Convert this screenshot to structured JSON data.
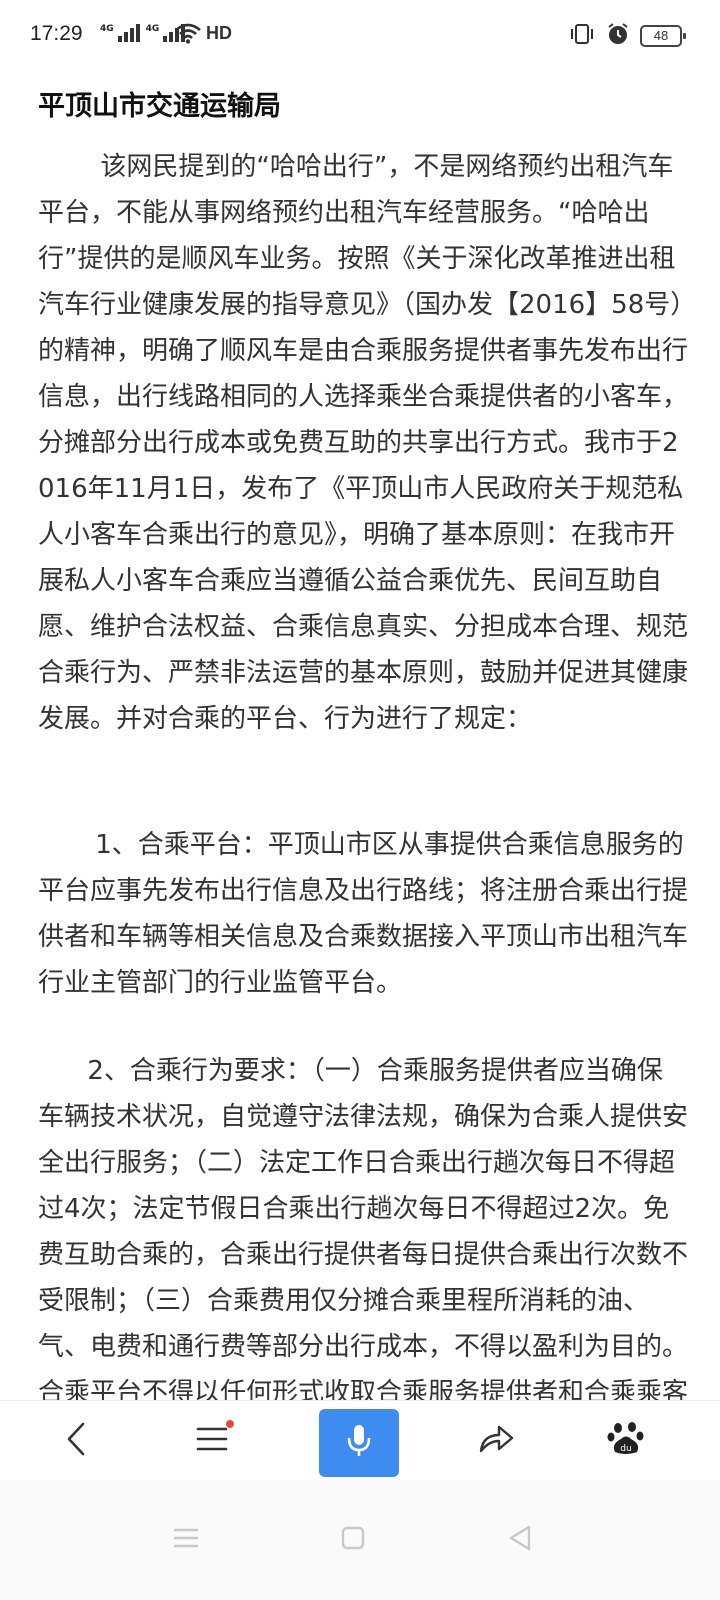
{
  "status_bar": {
    "time": "17:29",
    "signal1_label": "4G",
    "signal2_label": "4G",
    "hd_label": "HD",
    "battery_level": "48"
  },
  "article": {
    "title": "平顶山市交通运输局",
    "paragraphs": [
      "该网民提到的“哈哈出行”，不是网络预约出租汽车平台，不能从事网络预约出租汽车经营服务。“哈哈出行”提供的是顺风车业务。按照《关于深化改革推进出租汽车行业健康发展的指导意见》（国办发【2016】58号）的精神，明确了顺风车是由合乘服务提供者事先发布出行信息，出行线路相同的人选择乘坐合乘提供者的小客车，分摊部分出行成本或免费互助的共享出行方式。我市于2016年11月1日，发布了《平顶山市人民政府关于规范私人小客车合乘出行的意见》，明确了基本原则：在我市开展私人小客车合乘应当遵循公益合乘优先、民间互助自愿、维护合法权益、合乘信息真实、分担成本合理、规范合乘行为、严禁非法运营的基本原则，鼓励并促进其健康发展。并对合乘的平台、行为进行了规定：",
      "1、合乘平台：平顶山市区从事提供合乘信息服务的平台应事先发布出行信息及出行路线；将注册合乘出行提供者和车辆等相关信息及合乘数据接入平顶山市出租汽车行业主管部门的行业监管平台。",
      "2、合乘行为要求：（一）合乘服务提供者应当确保车辆技术状况，自觉遵守法律法规，确保为合乘人提供安全出行服务；（二）法定工作日合乘出行趟次每日不得超过4次；法定节假日合乘出行趟次每日不得超过2次。免费互助合乘的，合乘出行提供者每日提供合乘出行次数不受限制；（三）合乘费用仅分摊合乘里程所消耗的油、气、电费和通行费等部分出行成本，不得以盈利为目的。合乘平台不得以任何形式收取合乘服务提供者和合乘乘客的服务费用。"
    ]
  },
  "toolbar": {
    "icons": [
      "back-icon",
      "menu-icon",
      "microphone-icon",
      "share-icon",
      "baidu-paw-icon"
    ],
    "accent_color": "#3f8cf0",
    "badge_color": "#e8473c"
  },
  "nav_bar": {
    "icons": [
      "recent-apps-icon",
      "home-icon",
      "back-triangle-icon"
    ]
  }
}
